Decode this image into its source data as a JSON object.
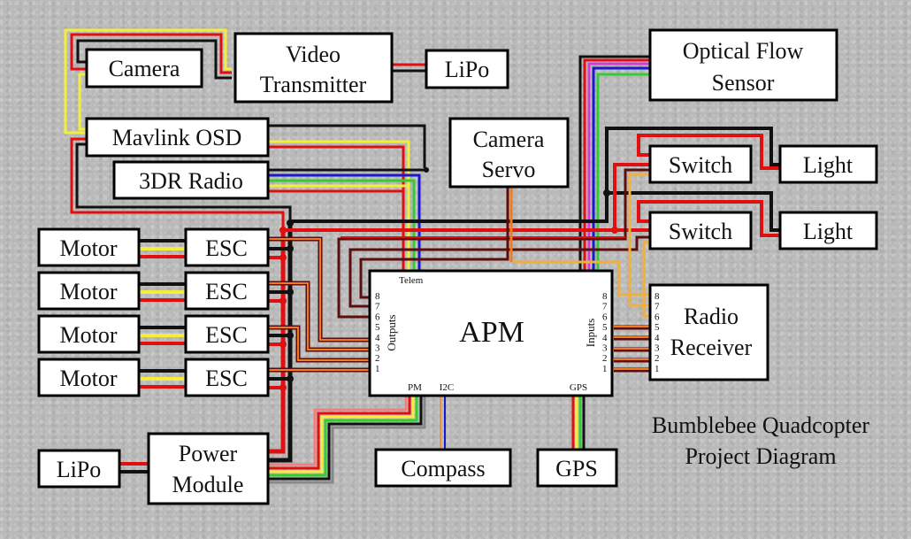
{
  "title": {
    "line1": "Bumblebee Quadcopter",
    "line2": "Project  Diagram"
  },
  "components": {
    "camera": "Camera",
    "video_tx_1": "Video",
    "video_tx_2": "Transmitter",
    "lipo_top": "LiPo",
    "optical_flow_1": "Optical Flow",
    "optical_flow_2": "Sensor",
    "mavlink_osd": "Mavlink OSD",
    "radio_3dr": "3DR Radio",
    "camera_servo_1": "Camera",
    "camera_servo_2": "Servo",
    "switch_1": "Switch",
    "switch_2": "Switch",
    "light_1": "Light",
    "light_2": "Light",
    "motors": [
      "Motor",
      "Motor",
      "Motor",
      "Motor"
    ],
    "escs": [
      "ESC",
      "ESC",
      "ESC",
      "ESC"
    ],
    "apm": "APM",
    "radio_rx_1": "Radio",
    "radio_rx_2": "Receiver",
    "lipo_bottom": "LiPo",
    "power_module_1": "Power",
    "power_module_2": "Module",
    "compass": "Compass",
    "gps": "GPS"
  },
  "apm_ports": {
    "telem": "Telem",
    "outputs": "Outputs",
    "inputs": "Inputs",
    "pm": "PM",
    "i2c": "I2C",
    "gps": "GPS",
    "pins": [
      "8",
      "7",
      "6",
      "5",
      "4",
      "3",
      "2",
      "1"
    ]
  },
  "receiver_pins": [
    "8",
    "7",
    "6",
    "5",
    "4",
    "3",
    "2",
    "1"
  ],
  "wire_colors": {
    "power": "#e01010",
    "ground": "#111111",
    "signal": "#f29a2e",
    "signal_dark": "#5a0e0e",
    "yellow": "#f4ee3a",
    "green": "#33cc33",
    "blue": "#1a1acc",
    "magenta": "#d63ad6",
    "pink": "#f08080",
    "orange_light": "#f0b040"
  }
}
